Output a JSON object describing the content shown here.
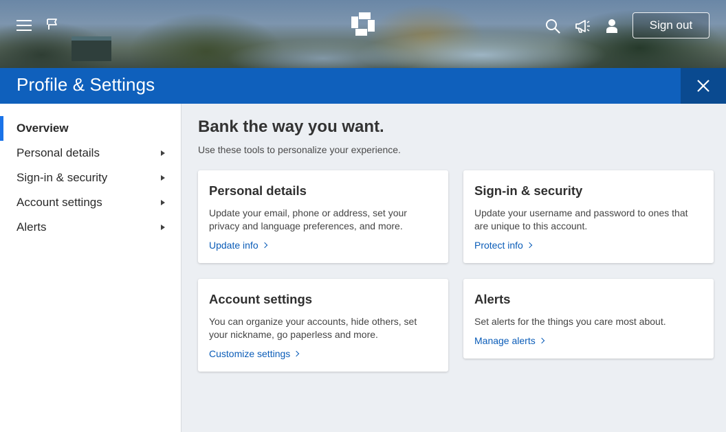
{
  "header": {
    "sign_out_label": "Sign out",
    "icons": [
      "menu-icon",
      "flag-icon",
      "chase-logo",
      "search-icon",
      "megaphone-icon",
      "profile-icon"
    ]
  },
  "title_bar": {
    "title": "Profile & Settings",
    "close_icon": "close-icon"
  },
  "sidebar": {
    "items": [
      {
        "label": "Overview",
        "active": true,
        "has_caret": false
      },
      {
        "label": "Personal details",
        "active": false,
        "has_caret": true
      },
      {
        "label": "Sign-in & security",
        "active": false,
        "has_caret": true
      },
      {
        "label": "Account settings",
        "active": false,
        "has_caret": true
      },
      {
        "label": "Alerts",
        "active": false,
        "has_caret": true
      }
    ]
  },
  "main": {
    "heading": "Bank the way you want.",
    "subheading": "Use these tools to personalize your experience.",
    "cards": [
      {
        "title": "Personal details",
        "description": "Update your email, phone or address, set your privacy and language preferences, and more.",
        "link": "Update info"
      },
      {
        "title": "Sign-in & security",
        "description": "Update your username and password to ones that are unique to this account.",
        "link": "Protect info"
      },
      {
        "title": "Account settings",
        "description": "You can organize your accounts, hide others, set your nickname, go paperless and more.",
        "link": "Customize settings"
      },
      {
        "title": "Alerts",
        "description": "Set alerts for the things you care most about.",
        "link": "Manage alerts"
      }
    ]
  },
  "colors": {
    "title_bar": "#0f60bc",
    "close_button": "#0a4a90",
    "link": "#0a5cb8",
    "active_indicator": "#1a73e8",
    "page_background": "#eceff3"
  }
}
